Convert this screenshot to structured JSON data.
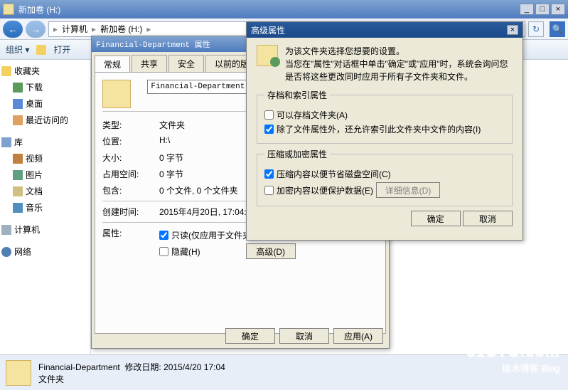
{
  "window": {
    "title": "新加卷 (H:)",
    "min": "_",
    "max": "□",
    "close": "×"
  },
  "addressbar": {
    "back": "←",
    "fwd": "→",
    "seg1": "计算机",
    "seg2": "新加卷 (H:)",
    "arrow": "▸",
    "refresh": "↻",
    "search": "🔍"
  },
  "toolbar": {
    "organize": "组织 ▾",
    "open": "打开"
  },
  "sidebar": {
    "favorites": "收藏夹",
    "downloads": "下载",
    "desktop": "桌面",
    "recent": "最近访问的",
    "libraries": "库",
    "videos": "视频",
    "pictures": "图片",
    "documents": "文档",
    "music": "音乐",
    "computer": "计算机",
    "network": "网络"
  },
  "statusbar": {
    "name": "Financial-Department",
    "mod_label": "修改日期:",
    "mod_val": "2015/4/20 17:04",
    "type": "文件夹"
  },
  "props": {
    "title": "Financial-Department 属性",
    "tabs": {
      "general": "常规",
      "share": "共享",
      "security": "安全",
      "prev": "以前的版本"
    },
    "name": "Financial-Department",
    "type_l": "类型:",
    "type_v": "文件夹",
    "loc_l": "位置:",
    "loc_v": "H:\\",
    "size_l": "大小:",
    "size_v": "0 字节",
    "disk_l": "占用空间:",
    "disk_v": "0 字节",
    "cont_l": "包含:",
    "cont_v": "0 个文件, 0 个文件夹",
    "ctime_l": "创建时间:",
    "ctime_v": "2015年4月20日, 17:04:4",
    "attr_l": "属性:",
    "readonly": "只读(仅应用于文件夹",
    "hidden": "隐藏(H)",
    "advanced": "高级(D)",
    "ok": "确定",
    "cancel": "取消",
    "apply": "应用(A)"
  },
  "adv": {
    "title": "高级属性",
    "close": "×",
    "info1": "为该文件夹选择您想要的设置。",
    "info2": "当您在\"属性\"对话框中单击\"确定\"或\"应用\"时，系统会询问您是否将这些更改同时应用于所有子文件夹和文件。",
    "grp1": "存档和索引属性",
    "cb1": "可以存档文件夹(A)",
    "cb2": "除了文件属性外，还允许索引此文件夹中文件的内容(I)",
    "grp2": "压缩或加密属性",
    "cb3": "压缩内容以便节省磁盘空间(C)",
    "cb4": "加密内容以便保护数据(E)",
    "details": "详细信息(D)",
    "ok": "确定",
    "cancel": "取消"
  },
  "watermark": {
    "line1": "51CTO.com",
    "line2": "技术博客  Blog"
  }
}
